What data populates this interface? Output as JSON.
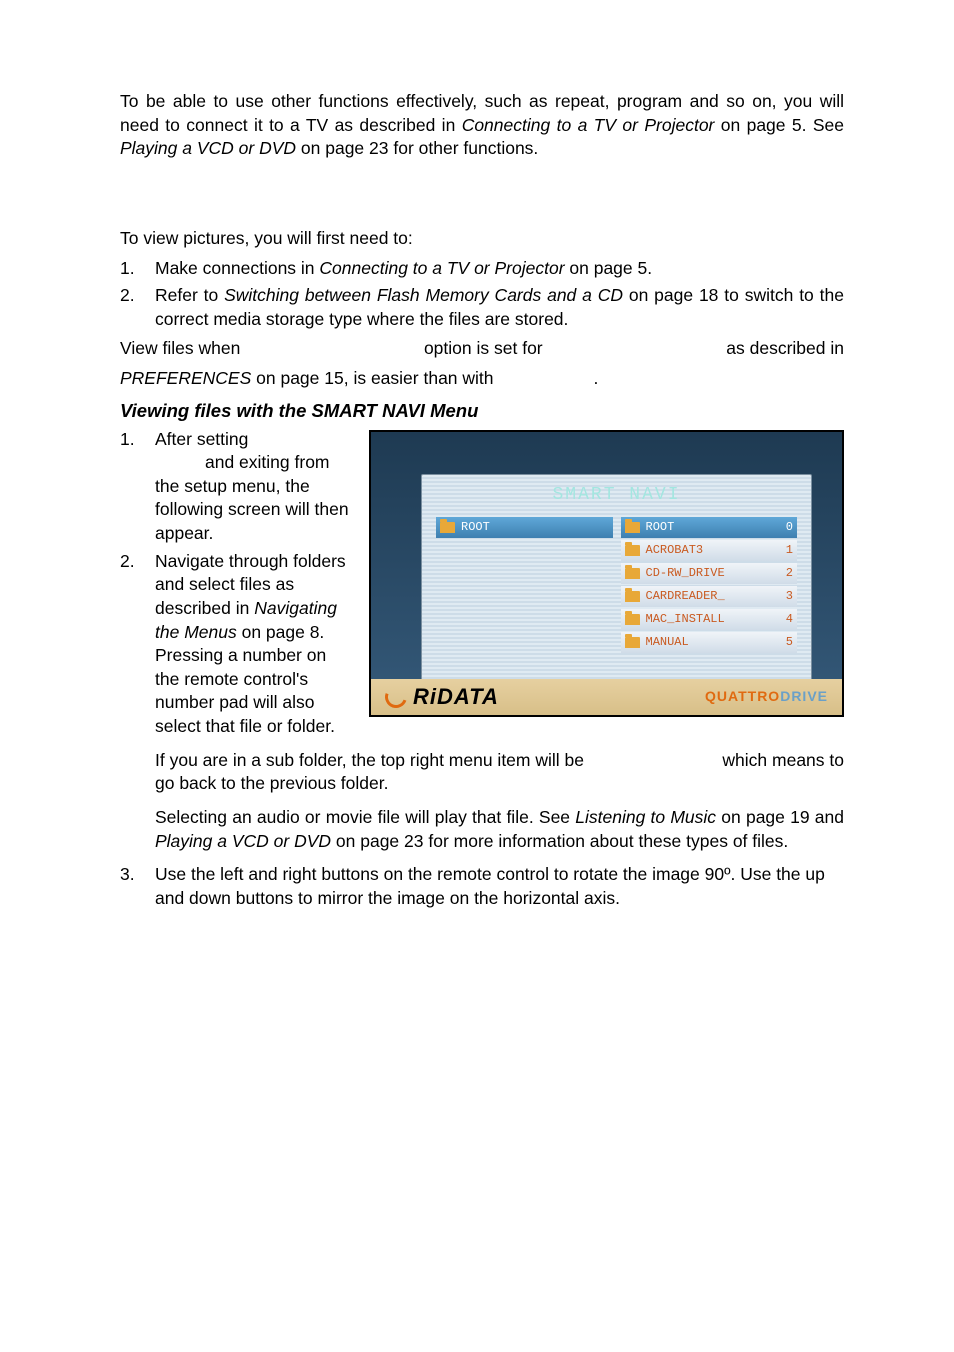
{
  "intro": {
    "line1a": "To be able to use other functions effectively, such as repeat, program and so on, you will need to connect it to a TV as described in ",
    "ref1": "Connecting to a TV or Projector",
    "line1b": " on page 5.  See ",
    "ref2": "Playing a VCD or DVD",
    "line1c": " on page 23 for other functions."
  },
  "pics": {
    "lead": "To view pictures, you will first need to:",
    "item1a": "Make connections in ",
    "item1ref": "Connecting to a TV or Projector",
    "item1b": " on page 5.",
    "item2a": "Refer to ",
    "item2ref": "Switching between Flash Memory Cards and a CD",
    "item2b": " on page 18 to switch to the correct media storage type where the files are stored."
  },
  "viewfiles": {
    "a": "View  files  when",
    "b": "option  is  set  for",
    "c": "as  described  in",
    "pref": "PREFERENCES",
    "d": " on page 15, is easier than with",
    "dot": "."
  },
  "subhead": "Viewing files with the SMART NAVI Menu",
  "steps": {
    "s1": "After setting",
    "s1b": "and exiting from the setup menu, the following screen will then appear.",
    "s2a": "Navigate through folders and select files as described in ",
    "s2ref": "Navigating the Menus",
    "s2b": " on page 8.  Pressing a number on the remote control's number pad will also select that file or folder.",
    "s2c_a": "If you are in a sub folder, the top right menu item will be",
    "s2c_b": "which means to go back to the previous folder.",
    "s2d_a": "Selecting an audio or movie file will play that file.  See ",
    "s2d_ref": "Listening to Music",
    "s2d_b": " on page 19 and ",
    "s2d_ref2": "Playing a VCD or DVD",
    "s2d_c": " on page 23 for more information about these types of files.",
    "s3": "Use the left and right buttons on the remote control to rotate the image 90º.  Use the up and down buttons to mirror the image on the horizontal axis."
  },
  "screenshot": {
    "title": "SMART  NAVI",
    "left": [
      {
        "label": "ROOT",
        "hl": true
      }
    ],
    "right": [
      {
        "label": "ROOT",
        "num": "0",
        "hl": true
      },
      {
        "label": "ACROBAT3",
        "num": "1"
      },
      {
        "label": "CD-RW_DRIVE",
        "num": "2"
      },
      {
        "label": "CARDREADER_",
        "num": "3"
      },
      {
        "label": "MAC_INSTALL",
        "num": "4"
      },
      {
        "label": "MANUAL",
        "num": "5"
      }
    ],
    "brand_left": "RiDATA",
    "brand_right_a": "QUATTRO",
    "brand_right_b": "DRIVE"
  },
  "nums": {
    "n1": "1.",
    "n2": "2.",
    "n3": "3."
  }
}
